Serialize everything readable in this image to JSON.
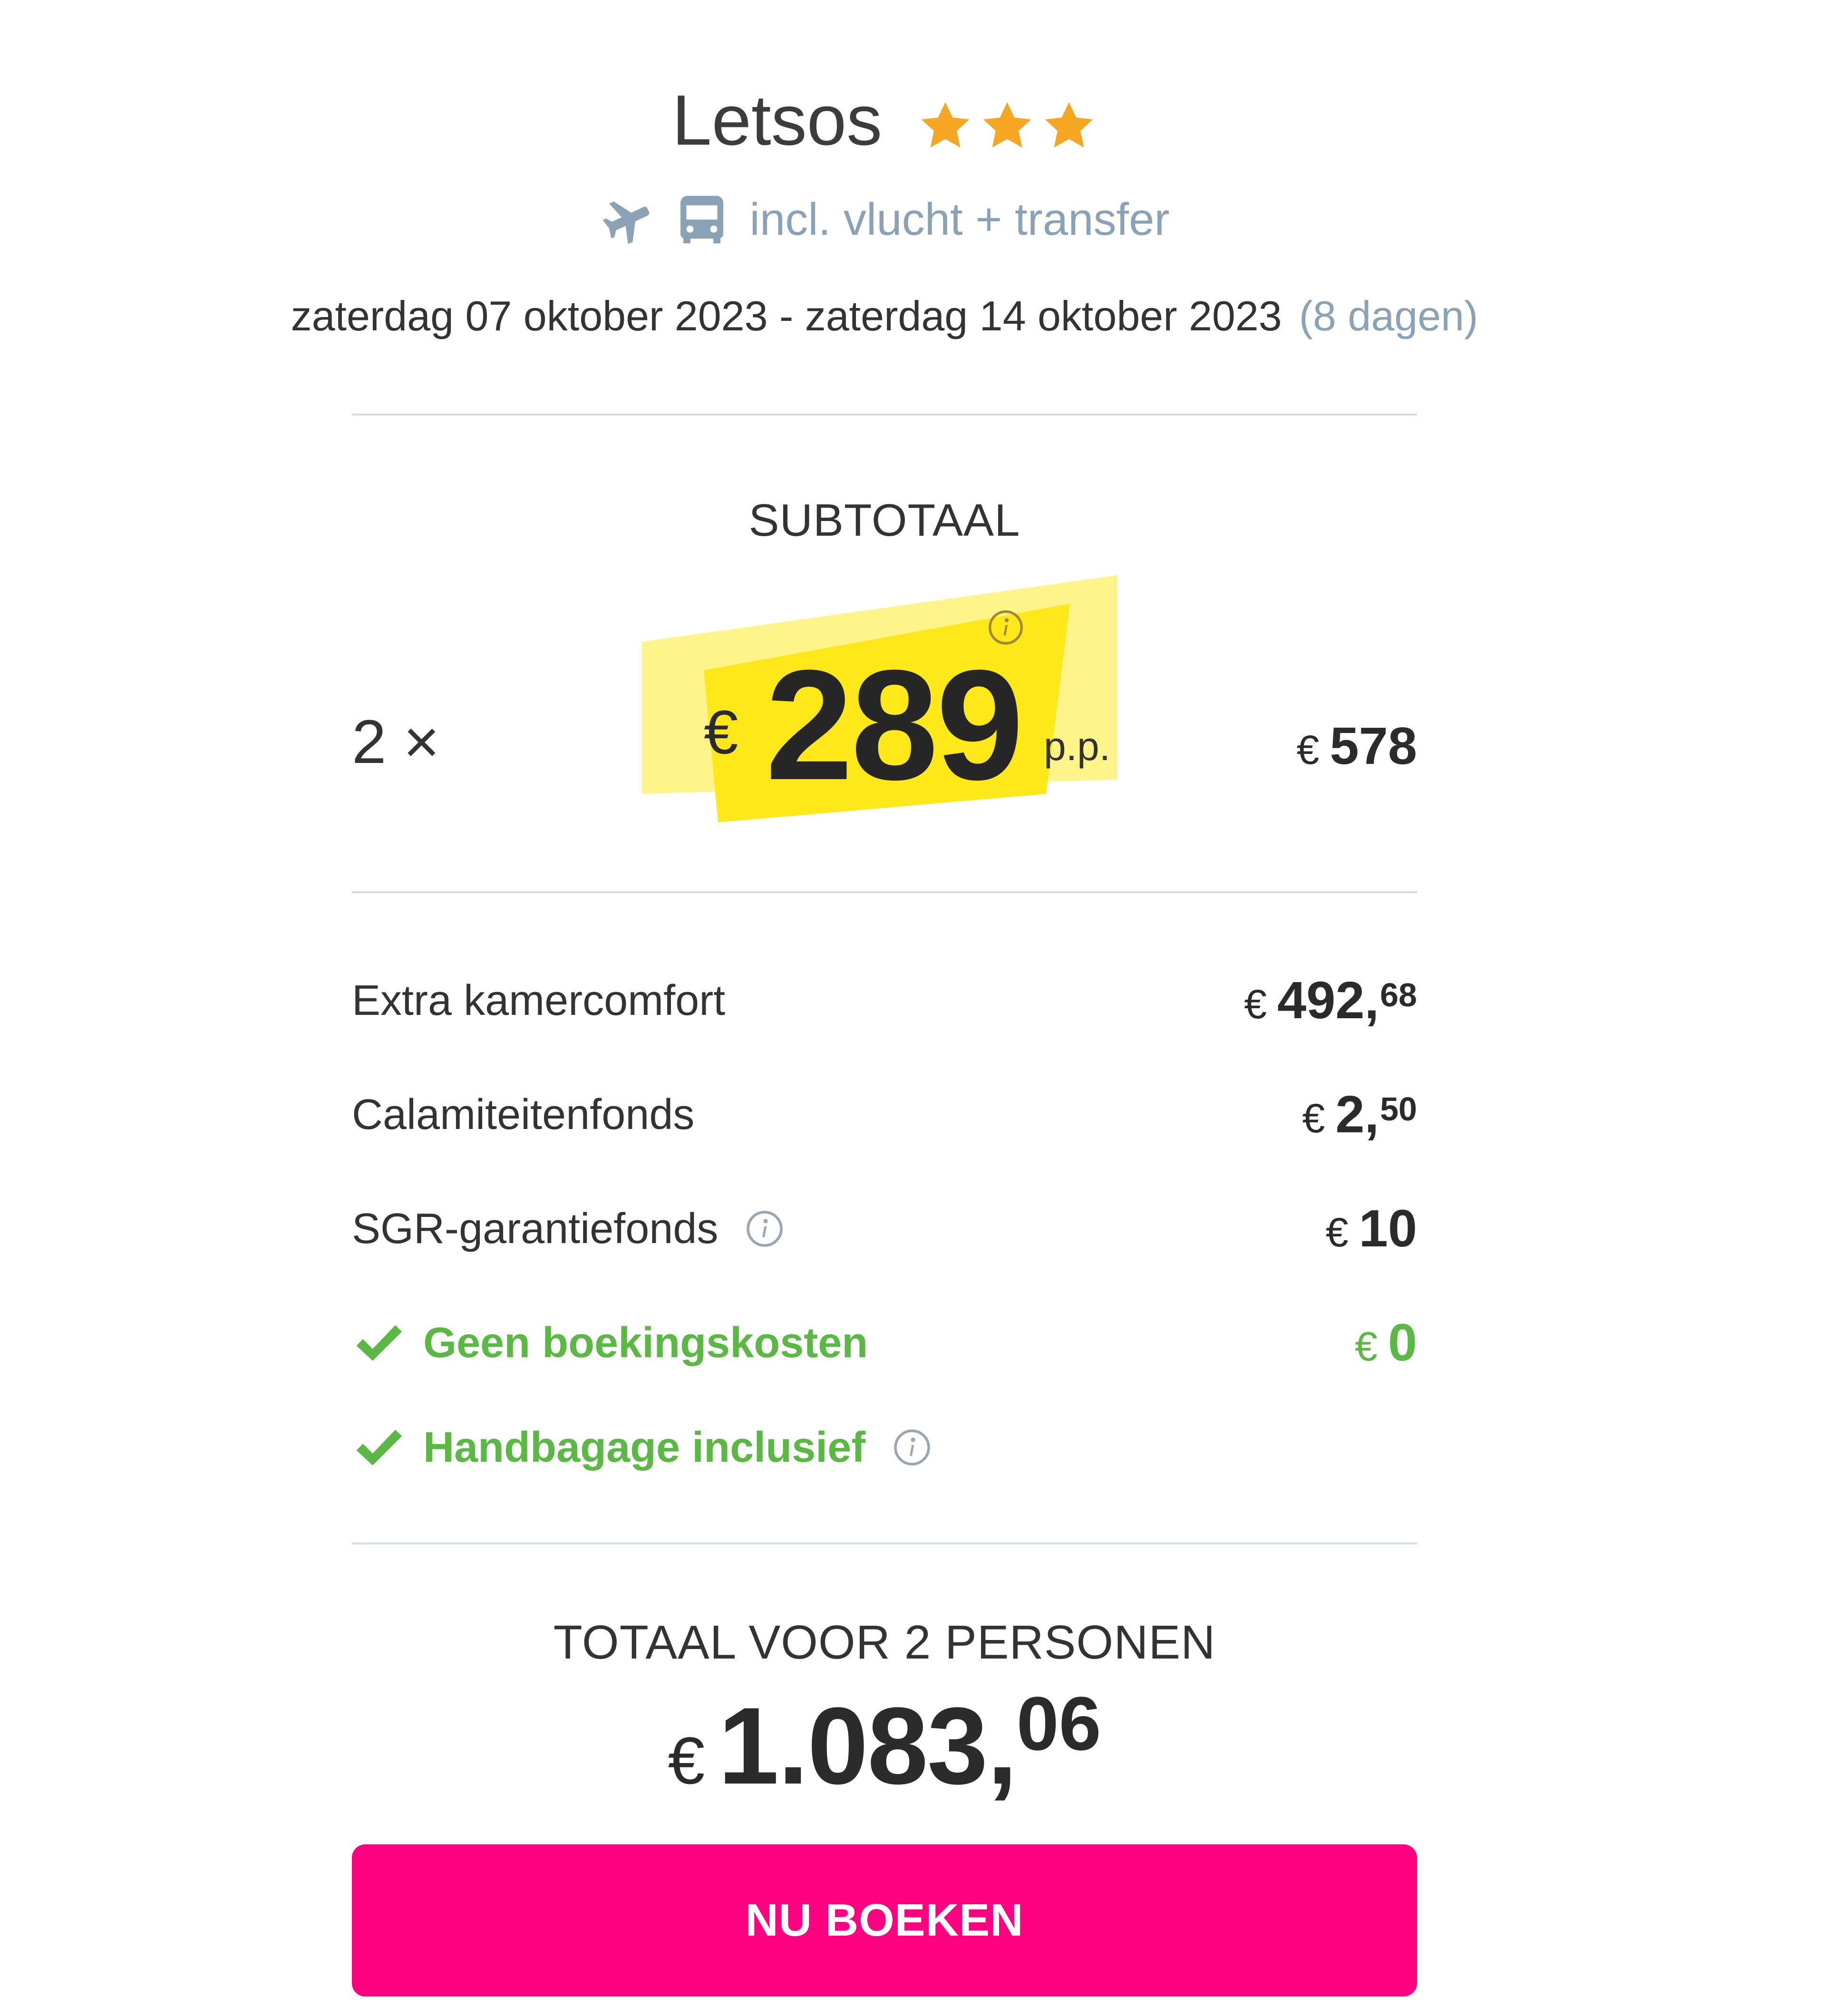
{
  "hotel": {
    "name": "Letsos",
    "stars": 3,
    "star_color": "#f5a623"
  },
  "transport": {
    "icons": [
      "airplane-icon",
      "bus-icon"
    ],
    "text": "incl. vlucht + transfer"
  },
  "dates": {
    "range": "zaterdag 07 oktober 2023 - zaterdag 14 oktober 2023",
    "duration": "(8 dagen)"
  },
  "subtotal": {
    "label": "SUBTOTAAL",
    "quantity": "2 ×",
    "currency": "€",
    "price_per_person": "289",
    "per_person_suffix": "p.p.",
    "line_total": "578",
    "highlight_color": "#ffe81a"
  },
  "costs": [
    {
      "label": "Extra kamercomfort",
      "currency": "€",
      "amount": "492,",
      "decimals": "68"
    },
    {
      "label": "Calamiteitenfonds",
      "currency": "€",
      "amount": "2,",
      "decimals": "50"
    },
    {
      "label": "SGR-garantiefonds",
      "currency": "€",
      "amount": "10",
      "decimals": ""
    },
    {
      "label": "Geen boekingskosten",
      "currency": "€",
      "amount": "0",
      "decimals": ""
    },
    {
      "label": "Handbagage inclusief",
      "currency": "",
      "amount": "",
      "decimals": ""
    }
  ],
  "total": {
    "label": "TOTAAL VOOR 2 PERSONEN",
    "currency": "€",
    "amount": "1.083,",
    "decimals": "06"
  },
  "cta": {
    "label": "NU BOEKEN",
    "color": "#ff0080"
  },
  "colors": {
    "green": "#5cb844",
    "muted_blue": "#8aa2b6"
  }
}
